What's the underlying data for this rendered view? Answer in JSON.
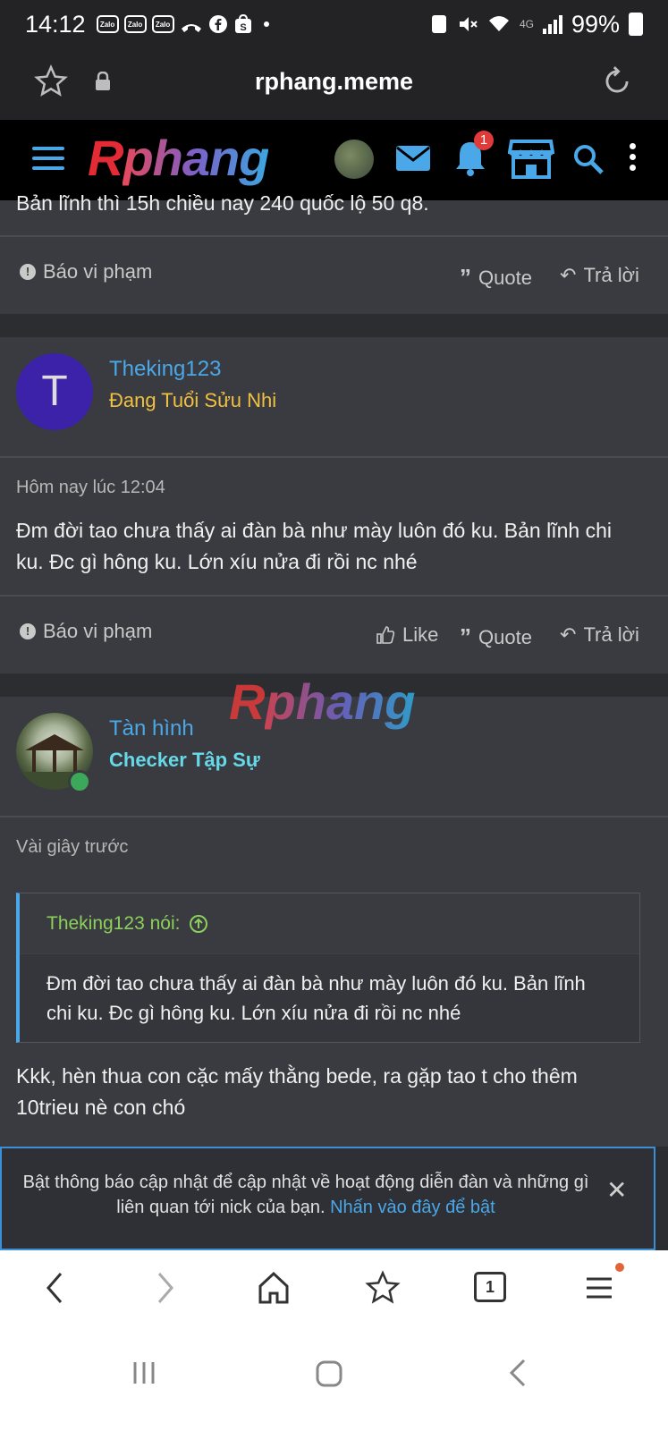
{
  "status_bar": {
    "time": "14:12",
    "app_icons": [
      "Zalo",
      "Zalo",
      "Zalo"
    ],
    "network": "4G",
    "battery": "99%"
  },
  "browser": {
    "url": "rphang.meme"
  },
  "site": {
    "logo_r": "R",
    "logo_rest": "phang",
    "notification_count": "1"
  },
  "prev_post": {
    "text": "Bản lĩnh thì 15h chiều nay 240 quốc lộ 50 q8.",
    "report": "Báo vi phạm",
    "quote": "Quote",
    "reply": "Trả lời"
  },
  "post1": {
    "avatar_letter": "T",
    "username": "Theking123",
    "user_title": "Đang Tuổi Sửu Nhi",
    "time": "Hôm nay lúc 12:04",
    "text": "Đm đời tao chưa thấy ai đàn bà như mày luôn đó ku. Bản lĩnh chi ku. Đc gì hông ku. Lớn xíu nửa đi rồi nc nhé",
    "report": "Báo vi phạm",
    "like": "Like",
    "quote": "Quote",
    "reply": "Trả lời"
  },
  "watermark": {
    "r": "R",
    "rest": "phang"
  },
  "post2": {
    "username": "Tàn hình",
    "user_title": "Checker Tập Sự",
    "time": "Vài giây trước",
    "quote_author": "Theking123 nói:",
    "quote_text": "Đm đời tao chưa thấy ai đàn bà như mày luôn đó ku. Bản lĩnh chi ku. Đc gì hông ku. Lớn xíu nửa đi rồi nc nhé",
    "text": "Kkk, hèn thua con cặc mấy thằng bede, ra gặp tao t cho thêm 10trieu nè con chó"
  },
  "notification": {
    "text": "Bật thông báo cập nhật để cập nhật về hoạt động diễn đàn và những gì liên quan tới nick của bạn.",
    "link": "Nhấn vào đây để bật"
  },
  "browser_nav": {
    "tab_count": "1"
  },
  "colors": {
    "accent": "#4aa8e8",
    "post_bg": "#3a3b40",
    "page_bg": "#2c2d31",
    "gold": "#f0c040",
    "cyan": "#66d9e8",
    "quote_green": "#8bd05a"
  },
  "icons": [
    "star-icon",
    "lock-icon",
    "reload-icon",
    "hamburger-icon",
    "mail-icon",
    "bell-icon",
    "store-icon",
    "search-icon",
    "more-icon",
    "report-icon",
    "quote-icon",
    "reply-icon",
    "like-icon",
    "close-icon",
    "back-icon",
    "forward-icon",
    "home-icon",
    "bookmark-icon",
    "tabs-icon",
    "menu-icon"
  ]
}
